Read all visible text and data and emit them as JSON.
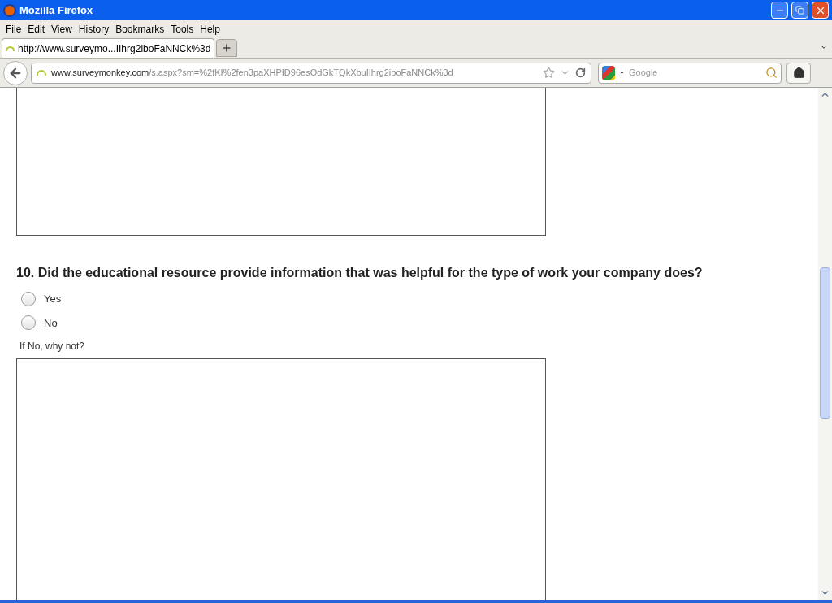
{
  "window": {
    "title": "Mozilla Firefox"
  },
  "menu": [
    "File",
    "Edit",
    "View",
    "History",
    "Bookmarks",
    "Tools",
    "Help"
  ],
  "tabs": [
    {
      "label": "http://www.surveymo...IIhrg2iboFaNNCk%3d",
      "selected": true
    }
  ],
  "address_bar": {
    "host": "www.surveymonkey.com",
    "path": "/s.aspx?sm=%2fKI%2fen3paXHPID96esOdGkTQkXbuIIhrg2iboFaNNCk%3d"
  },
  "search": {
    "placeholder": "Google"
  },
  "question": {
    "title": "10. Did the educational resource provide information that was helpful for the type of work your company does?",
    "options": [
      {
        "label": "Yes",
        "selected": false
      },
      {
        "label": "No",
        "selected": false
      }
    ],
    "comment_label": "If No, why not?"
  }
}
